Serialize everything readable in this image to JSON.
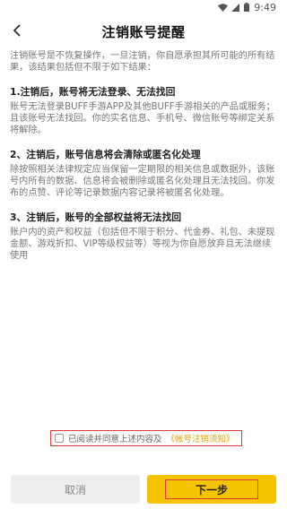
{
  "status_bar": {
    "time": "9:49",
    "icons": [
      "wifi-icon",
      "signal-icon",
      "battery-icon"
    ]
  },
  "header": {
    "title": "注销账号提醒",
    "back_icon": "chevron-left-icon"
  },
  "content": {
    "intro": "注销账号是不恢复操作，一旦注销，你自愿承担其所可能的所有结果，该结果包括但不限于如下结果：",
    "sections": [
      {
        "title": "1.注销后，账号将无法登录、无法找回",
        "body": "账号无法登录BUFF手游APP及其他BUFF手游相关的产品或服务；且该账号无法找回。你的实名信息、手机号、微信账号等绑定关系将解除。"
      },
      {
        "title": "2、注销后，账号信息将会清除或匿名化处理",
        "body": "除按照相关法律规定应当保留一定期限的相关信息或数据外，该账号内所有的数据、信息将会被删除或匿名化处理且无法找回。你发布的点赞、评论等记录数据内容记录将被匿名化处理。"
      },
      {
        "title": "3、注销后，账号的全部权益将无法找回",
        "body": "账户内的资产和权益（包括但不限于积分、代金券、礼包、未提现金额、游戏折扣、VIP等级权益等）等视为你自愿放弃且无法继续使用"
      }
    ]
  },
  "agreement": {
    "text": "已阅读并同意上述内容及",
    "link": "《帐号注销须知》",
    "checked": false
  },
  "buttons": {
    "cancel": "取消",
    "next": "下一步"
  },
  "colors": {
    "accent": "#f5c400",
    "highlight_border": "#e23a3a",
    "link": "#e0a000"
  }
}
